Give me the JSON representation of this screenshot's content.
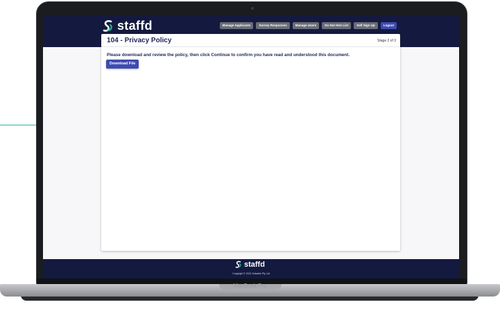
{
  "app": {
    "brand": "staffd",
    "nav": [
      "Manage Applicants",
      "Survey Responses",
      "Manage Users",
      "Do Not Hire List",
      "Self Sign Up",
      "Logout"
    ]
  },
  "page": {
    "title": "104 - Privacy Policy",
    "stage": "Stage 2 of 3",
    "instructions": "Please download and review the policy, then click Continue to confirm you have read and understood this document.",
    "download_label": "Download File"
  },
  "footer": {
    "brand": "staffd",
    "copyright": "Copyright © 2021 Solvable Pty Ltd"
  },
  "device": {
    "model": "MacBook Pro"
  },
  "colors": {
    "header_bg": "#141a3f",
    "accent": "#3f4bb2",
    "nav_button": "#6a6d76",
    "logo_teal": "#2bb59a"
  }
}
